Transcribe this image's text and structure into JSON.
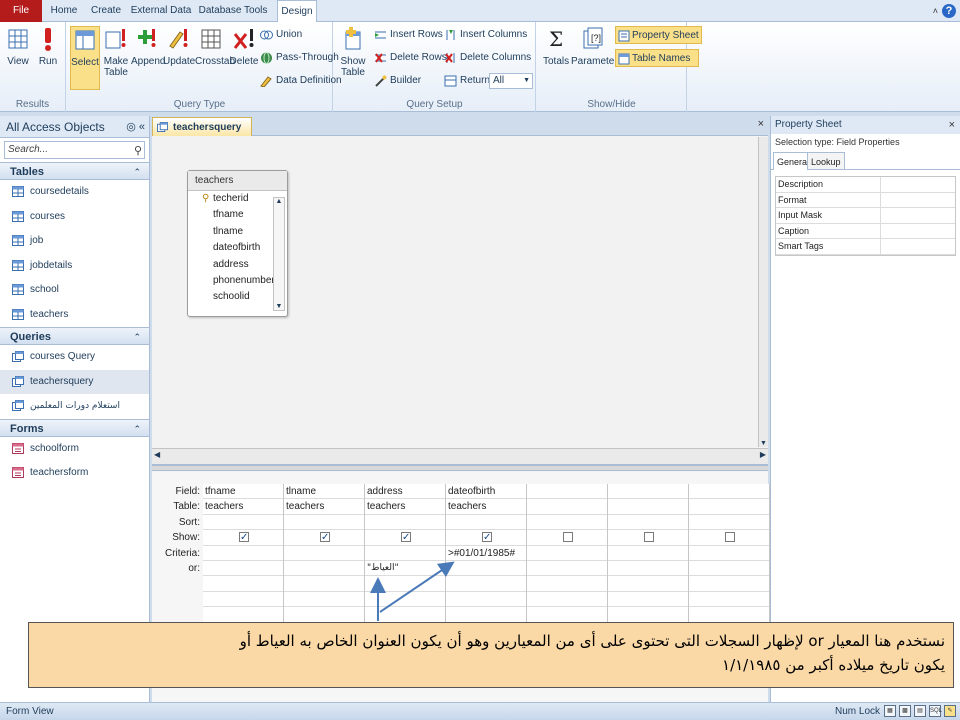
{
  "ribbon_tabs": [
    {
      "label": "File"
    },
    {
      "label": "Home"
    },
    {
      "label": "Create"
    },
    {
      "label": "External Data"
    },
    {
      "label": "Database Tools"
    },
    {
      "label": "Design"
    }
  ],
  "groups": {
    "results": {
      "label": "Results",
      "view": "View",
      "run": "Run"
    },
    "query_type": {
      "label": "Query Type",
      "select": "Select",
      "make_table_1": "Make",
      "make_table_2": "Table",
      "append": "Append",
      "update": "Update",
      "crosstab": "Crosstab",
      "delete": "Delete",
      "union": "Union",
      "pass_through": "Pass-Through",
      "data_definition": "Data Definition"
    },
    "query_setup": {
      "label": "Query Setup",
      "show_table_1": "Show",
      "show_table_2": "Table",
      "insert_rows": "Insert Rows",
      "delete_rows": "Delete Rows",
      "builder": "Builder",
      "insert_columns": "Insert Columns",
      "delete_columns": "Delete Columns",
      "return_label": "Return:",
      "return_value": "All"
    },
    "show_hide": {
      "label": "Show/Hide",
      "totals": "Totals",
      "parameters": "Parameters",
      "property_sheet": "Property Sheet",
      "table_names": "Table Names"
    }
  },
  "nav": {
    "title": "All Access Objects",
    "search_placeholder": "Search...",
    "sections": [
      {
        "title": "Tables",
        "items": [
          "coursedetails",
          "courses",
          "job",
          "jobdetails",
          "school",
          "teachers"
        ]
      },
      {
        "title": "Queries",
        "items": [
          "courses Query",
          "teachersquery",
          "استعلام دورات المعلمين"
        ]
      },
      {
        "title": "Forms",
        "items": [
          "schoolform",
          "teachersform"
        ]
      }
    ]
  },
  "document": {
    "tab_title": "teachersquery",
    "field_list": {
      "title": "teachers",
      "fields": [
        "techerid",
        "tfname",
        "tlname",
        "dateofbirth",
        "address",
        "phonenumber",
        "schoolid"
      ]
    },
    "qbe": {
      "row_labels": [
        "Field:",
        "Table:",
        "Sort:",
        "Show:",
        "Criteria:",
        "or:"
      ],
      "columns": [
        {
          "field": "tfname",
          "table": "teachers",
          "sort": "",
          "show": true,
          "criteria": "",
          "or": ""
        },
        {
          "field": "tlname",
          "table": "teachers",
          "sort": "",
          "show": true,
          "criteria": "",
          "or": ""
        },
        {
          "field": "address",
          "table": "teachers",
          "sort": "",
          "show": true,
          "criteria": "",
          "or": "\"العياط\""
        },
        {
          "field": "dateofbirth",
          "table": "teachers",
          "sort": "",
          "show": true,
          "criteria": ">#01/01/1985#",
          "or": ""
        },
        {
          "field": "",
          "table": "",
          "sort": "",
          "show": false,
          "criteria": "",
          "or": ""
        },
        {
          "field": "",
          "table": "",
          "sort": "",
          "show": false,
          "criteria": "",
          "or": ""
        },
        {
          "field": "",
          "table": "",
          "sort": "",
          "show": false,
          "criteria": "",
          "or": ""
        }
      ]
    }
  },
  "property_sheet": {
    "title": "Property Sheet",
    "selection_type": "Selection type:  Field Properties",
    "tabs": [
      "General",
      "Lookup"
    ],
    "rows": [
      {
        "name": "Description",
        "value": ""
      },
      {
        "name": "Format",
        "value": ""
      },
      {
        "name": "Input Mask",
        "value": ""
      },
      {
        "name": "Caption",
        "value": ""
      },
      {
        "name": "Smart Tags",
        "value": ""
      }
    ]
  },
  "status": {
    "left": "Form View",
    "right": "Num Lock",
    "view_icons": [
      "datasheet-view",
      "pivot-table-view",
      "pivot-chart-view",
      "sql-view",
      "design-view"
    ]
  },
  "annotation": {
    "line1": "نستخدم هنا المعيار or لإظهار السجلات التى تحتوى على أى من المعيارين وهو أن يكون العنوان الخاص به العياط أو",
    "line2": "يكون تاريخ ميلاده أكبر من ١/١/١٩٨٥"
  },
  "colors": {
    "file_tab": "#b41b1b",
    "active_highlight": "#fbe08a",
    "annotation_bg": "#fbd9a6",
    "arrow": "#4a7ab8"
  }
}
